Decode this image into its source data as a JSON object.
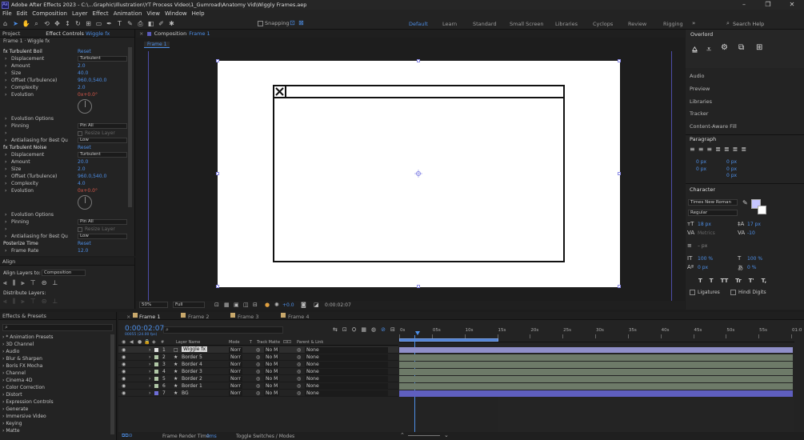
{
  "window": {
    "title": "Adobe After Effects 2023 - C:\\...Graphic\\Illustration\\YT Process Video\\1_Gumroad\\Anatomy Vid\\Wiggly Frames.aep",
    "logo": "Ae",
    "controls": [
      "–",
      "❐",
      "✕"
    ]
  },
  "menu": [
    "File",
    "Edit",
    "Composition",
    "Layer",
    "Effect",
    "Animation",
    "View",
    "Window",
    "Help"
  ],
  "toolbar": {
    "snapping": "Snapping",
    "workspaces": [
      "Default",
      "Learn",
      "Standard",
      "Small Screen",
      "Libraries",
      "Cyclops",
      "Review",
      "Rigging"
    ],
    "search": "Search Help"
  },
  "project_tab": "Project",
  "effect_controls": {
    "tab": "Effect Controls",
    "layer": "Wiggle fx",
    "breadcrumb": "Frame 1 · Wiggle fx",
    "rows": [
      {
        "indent": 0,
        "label": "fx  Turbulent Boil",
        "reset": "Reset"
      },
      {
        "indent": 1,
        "label": "Displacement",
        "dropdown": "Turbulent"
      },
      {
        "indent": 1,
        "label": "Amount",
        "value": "2.0"
      },
      {
        "indent": 1,
        "label": "Size",
        "value": "40.0"
      },
      {
        "indent": 1,
        "label": "Offset (Turbulence)",
        "value": "960.0,540.0"
      },
      {
        "indent": 1,
        "label": "Complexity",
        "value": "2.0"
      },
      {
        "indent": 1,
        "label": "Evolution",
        "value_red": "0x+0.0°"
      },
      {
        "indent": 1,
        "label": "Evolution Options"
      },
      {
        "indent": 1,
        "label": "Pinning",
        "dropdown": "Pin All"
      },
      {
        "indent": 1,
        "label": "",
        "checkbox": "Resize Layer"
      },
      {
        "indent": 1,
        "label": "Antialiasing for Best Qu",
        "dropdown": "Low"
      },
      {
        "indent": 0,
        "label": "fx  Turbulent Noise",
        "reset": "Reset"
      },
      {
        "indent": 1,
        "label": "Displacement",
        "dropdown": "Turbulent"
      },
      {
        "indent": 1,
        "label": "Amount",
        "value": "20.0"
      },
      {
        "indent": 1,
        "label": "Size",
        "value": "2.0"
      },
      {
        "indent": 1,
        "label": "Offset (Turbulence)",
        "value": "960.0,540.0"
      },
      {
        "indent": 1,
        "label": "Complexity",
        "value": "4.0"
      },
      {
        "indent": 1,
        "label": "Evolution",
        "value_red": "0x+0.0°"
      },
      {
        "indent": 1,
        "label": "Evolution Options"
      },
      {
        "indent": 1,
        "label": "Pinning",
        "dropdown": "Pin All"
      },
      {
        "indent": 1,
        "label": "",
        "checkbox": "Resize Layer"
      },
      {
        "indent": 1,
        "label": "Antialiasing for Best Qu",
        "dropdown": "Low"
      },
      {
        "indent": 0,
        "label": "Posterize Time",
        "reset": "Reset"
      },
      {
        "indent": 1,
        "label": "Frame Rate",
        "value": "12.0"
      }
    ]
  },
  "align": {
    "title": "Align",
    "align_to_label": "Align Layers to:",
    "align_to": "Composition",
    "distribute": "Distribute Layers:"
  },
  "effects_presets": {
    "title": "Effects & Presets",
    "items": [
      "* Animation Presets",
      "3D Channel",
      "Audio",
      "Blur & Sharpen",
      "Boris FX Mocha",
      "Channel",
      "Cinema 4D",
      "Color Correction",
      "Distort",
      "Expression Controls",
      "Generate",
      "Immersive Video",
      "Keying",
      "Matte"
    ]
  },
  "composition": {
    "tab": "Composition",
    "name": "Frame 1",
    "sub_tab": "Frame 1",
    "zoom": "50%",
    "quality": "Full",
    "exposure": "+0.0",
    "timecode": "0:00:02:07"
  },
  "right_panels": {
    "overlord": "Overlord",
    "list": [
      "Audio",
      "Preview",
      "Libraries",
      "Tracker",
      "Content-Aware Fill"
    ]
  },
  "paragraph": {
    "title": "Paragraph",
    "fields": [
      "0 px",
      "0 px",
      "0 px",
      "0 px",
      "0 px"
    ]
  },
  "character": {
    "title": "Character",
    "font": "Times New Roman",
    "style": "Regular",
    "size": "18 px",
    "leading": "17 px",
    "kerning": "Metrics",
    "tracking": "-10",
    "stroke": "– px",
    "vscale": "100 %",
    "hscale": "100 %",
    "baseline": "0 px",
    "tsume": "0 %",
    "styles": [
      "T",
      "T",
      "TT",
      "Tr",
      "T'",
      "T,"
    ],
    "ligatures": "Ligatures",
    "hindi": "Hindi Digits"
  },
  "timeline": {
    "tabs": [
      "Frame 1",
      "Frame 2",
      "Frame 3",
      "Frame 4"
    ],
    "timecode": "0:00:02:07",
    "fps": "00055 (24.00 fps)",
    "cols": [
      "#",
      "Layer Name",
      "Mode",
      "T",
      "Track Matte",
      "Parent & Link"
    ],
    "ruler": [
      "0s",
      "05s",
      "10s",
      "15s",
      "20s",
      "25s",
      "30s",
      "35s",
      "40s",
      "45s",
      "50s",
      "55s",
      "01:0"
    ],
    "layers": [
      {
        "num": "1",
        "name": "Wiggle fx",
        "mode": "Norr",
        "matte": "No M",
        "parent": "None",
        "selected": true,
        "color": "#e0e0e0"
      },
      {
        "num": "2",
        "name": "Border 5",
        "mode": "Norr",
        "matte": "No M",
        "parent": "None",
        "color": "#b0c7a6"
      },
      {
        "num": "3",
        "name": "Border 4",
        "mode": "Norr",
        "matte": "No M",
        "parent": "None",
        "color": "#b0c7a6"
      },
      {
        "num": "4",
        "name": "Border 3",
        "mode": "Norr",
        "matte": "No M",
        "parent": "None",
        "color": "#b0c7a6"
      },
      {
        "num": "5",
        "name": "Border 2",
        "mode": "Norr",
        "matte": "No M",
        "parent": "None",
        "color": "#b0c7a6"
      },
      {
        "num": "6",
        "name": "Border 1",
        "mode": "Norr",
        "matte": "No M",
        "parent": "None",
        "color": "#b0c7a6"
      },
      {
        "num": "7",
        "name": "BG",
        "mode": "Norr",
        "matte": "No M",
        "parent": "None",
        "color": "#6e6ed8"
      }
    ],
    "render_time_label": "Frame Render Time:",
    "render_time": "0ms",
    "toggle": "Toggle Switches / Modes"
  }
}
